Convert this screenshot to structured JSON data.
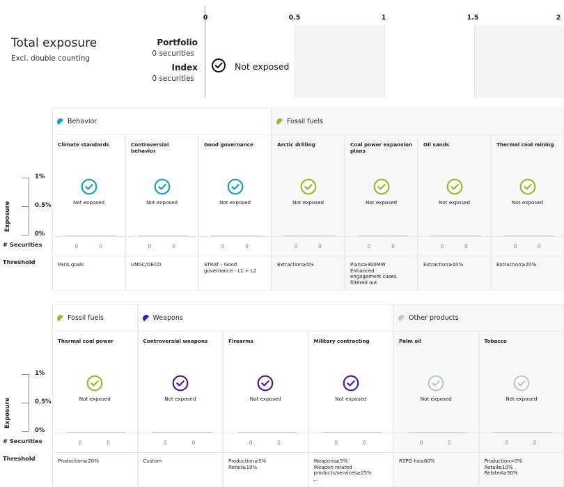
{
  "header": {
    "title": "Total exposure",
    "subtitle": "Excl. double counting",
    "portfolio_label": "Portfolio",
    "portfolio_count": "0 securities",
    "index_label": "Index",
    "index_count": "0 securities",
    "status": "Not exposed",
    "axis_ticks": [
      "0",
      "0.5",
      "1",
      "1.5",
      "2"
    ]
  },
  "axis": {
    "ylabel": "Exposure",
    "ticks": [
      "1%",
      "0.5%",
      "0%"
    ],
    "row_securities": "# Securities",
    "row_threshold": "Threshold"
  },
  "colors": {
    "behavior": "#1a9cbf",
    "fossil": "#9bb52e",
    "weapons": "#4b1a9c",
    "other": "#b9c7d6"
  },
  "chart_data": [
    {
      "type": "bar",
      "title": "Total exposure",
      "categories": [
        "Portfolio",
        "Index"
      ],
      "values": [
        0,
        0
      ],
      "xlim": [
        0,
        2
      ],
      "xticks": [
        0,
        0.5,
        1,
        1.5,
        2
      ]
    },
    {
      "type": "bar",
      "ylabel": "Exposure",
      "yticks": [
        "0%",
        "0.5%",
        "1%"
      ],
      "groups": [
        {
          "name": "Behavior",
          "color_key": "behavior",
          "categories": [
            {
              "name": "Climate standards",
              "status": "Not exposed",
              "portfolio_securities": "0",
              "index_securities": "0",
              "threshold": "Paris goals",
              "values": [
                0,
                0
              ]
            },
            {
              "name": "Controversial behavior",
              "status": "Not exposed",
              "portfolio_securities": "0",
              "index_securities": "0",
              "threshold": "UNGC/OECD",
              "values": [
                0,
                0
              ]
            },
            {
              "name": "Good governance",
              "status": "Not exposed",
              "portfolio_securities": "0",
              "index_securities": "0",
              "threshold": "STRAT - Good\ngovernance - L1 + L2",
              "values": [
                0,
                0
              ]
            }
          ]
        },
        {
          "name": "Fossil fuels",
          "color_key": "fossil",
          "categories": [
            {
              "name": "Arctic drilling",
              "status": "Not exposed",
              "portfolio_securities": "0",
              "index_securities": "0",
              "threshold": "Extraction≥5%",
              "values": [
                0,
                0
              ]
            },
            {
              "name": "Coal power expansion plans",
              "status": "Not exposed",
              "portfolio_securities": "0",
              "index_securities": "0",
              "threshold": "Plans≥300MW\nEnhanced\nengagement cases\nfiltered out",
              "values": [
                0,
                0
              ]
            },
            {
              "name": "Oil sands",
              "status": "Not exposed",
              "portfolio_securities": "0",
              "index_securities": "0",
              "threshold": "Extraction≥10%",
              "values": [
                0,
                0
              ]
            },
            {
              "name": "Thermal coal mining",
              "status": "Not exposed",
              "portfolio_securities": "0",
              "index_securities": "0",
              "threshold": "Extraction≥20%",
              "values": [
                0,
                0
              ]
            }
          ]
        }
      ]
    },
    {
      "type": "bar",
      "ylabel": "Exposure",
      "yticks": [
        "0%",
        "0.5%",
        "1%"
      ],
      "groups": [
        {
          "name": "Fossil fuels",
          "color_key": "fossil",
          "categories": [
            {
              "name": "Thermal coal power",
              "status": "Not exposed",
              "portfolio_securities": "0",
              "index_securities": "0",
              "threshold": "Production≥20%",
              "values": [
                0,
                0
              ]
            }
          ]
        },
        {
          "name": "Weapons",
          "color_key": "weapons",
          "categories": [
            {
              "name": "Controversial weapons",
              "status": "Not exposed",
              "portfolio_securities": "0",
              "index_securities": "0",
              "threshold": "Custom",
              "values": [
                0,
                0
              ]
            },
            {
              "name": "Firearms",
              "status": "Not exposed",
              "portfolio_securities": "0",
              "index_securities": "0",
              "threshold": "Production≥5%\nRetail≥10%",
              "values": [
                0,
                0
              ]
            },
            {
              "name": "Military contracting",
              "status": "Not exposed",
              "portfolio_securities": "0",
              "index_securities": "0",
              "threshold": "Weapons≥5%\nWeapon related\nproducts/services≥25%\n...",
              "values": [
                0,
                0
              ]
            }
          ]
        },
        {
          "name": "Other products",
          "color_key": "other",
          "categories": [
            {
              "name": "Palm oil",
              "status": "Not exposed",
              "portfolio_securities": "0",
              "index_securities": "0",
              "threshold": "RSPO ha≤80%",
              "values": [
                0,
                0
              ]
            },
            {
              "name": "Tobacco",
              "status": "Not exposed",
              "portfolio_securities": "0",
              "index_securities": "0",
              "threshold": "Production>0%\nRetail≥10%\nRelated≥50%",
              "values": [
                0,
                0
              ]
            }
          ]
        }
      ]
    }
  ]
}
